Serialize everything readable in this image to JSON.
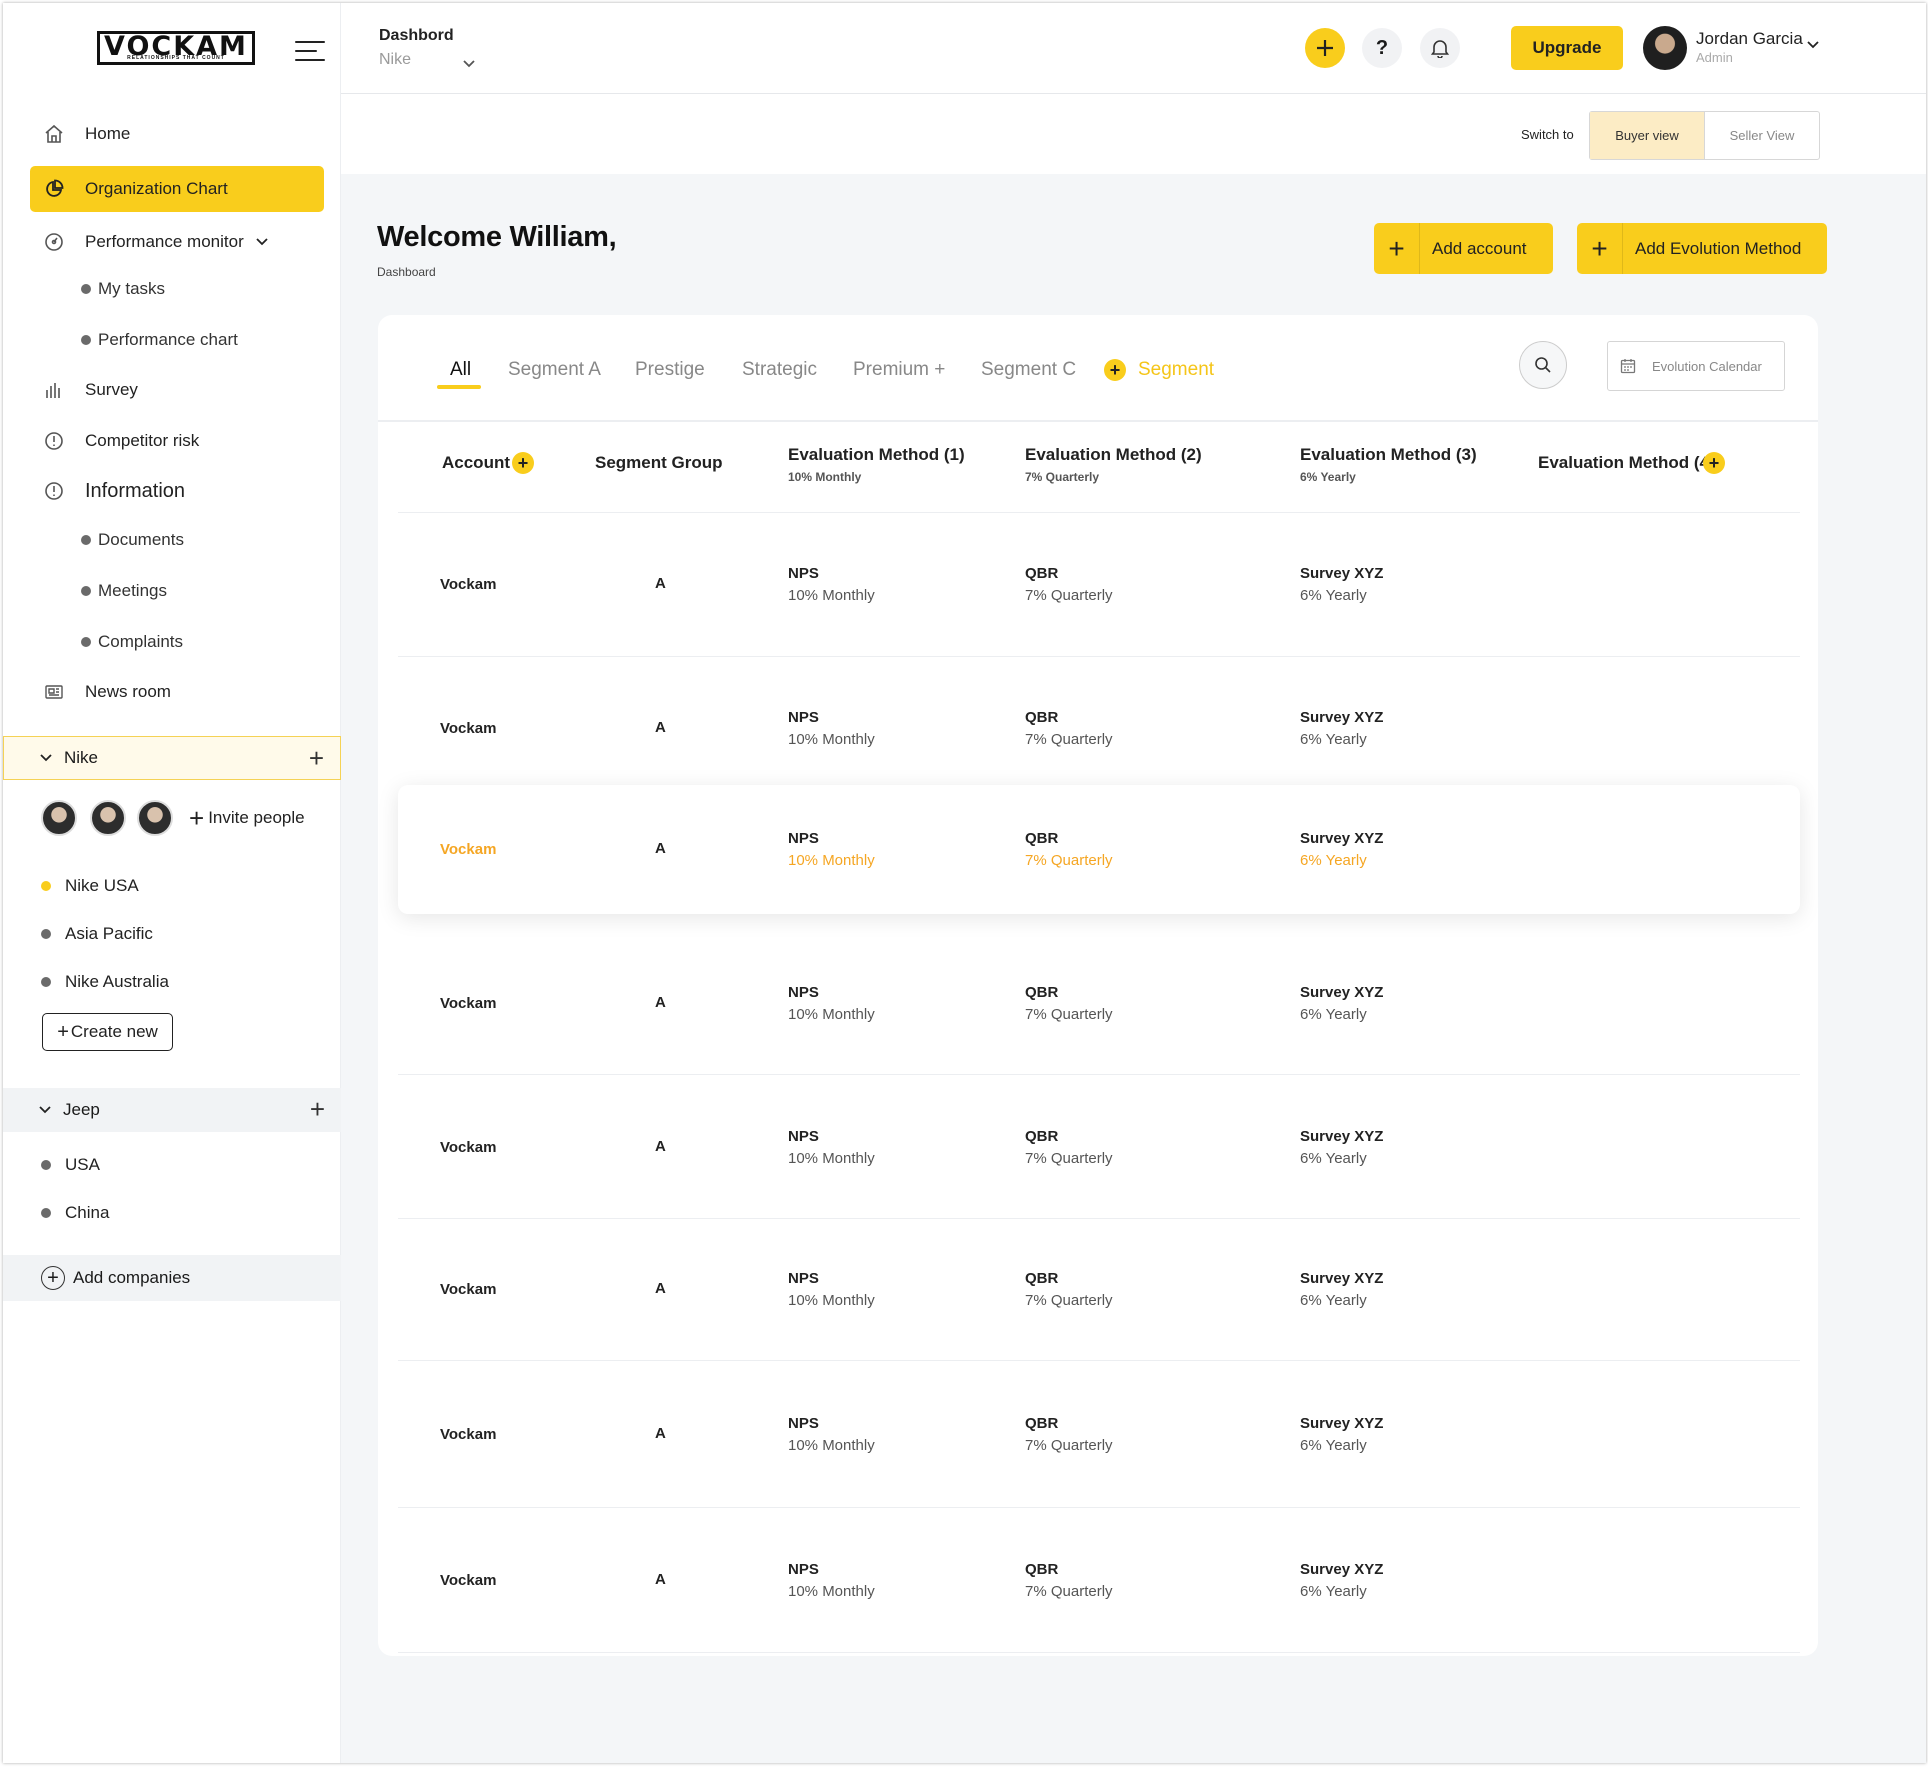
{
  "brand": {
    "name": "VOCKAM",
    "tagline": "RELATIONSHIPS THAT COUNT"
  },
  "nav": {
    "home": "Home",
    "org_chart": "Organization Chart",
    "performance_monitor": "Performance monitor",
    "my_tasks": "My tasks",
    "performance_chart": "Performance chart",
    "survey": "Survey",
    "competitor_risk": "Competitor risk",
    "information": "Information",
    "documents": "Documents",
    "meetings": "Meetings",
    "complaints": "Complaints",
    "news_room": "News room"
  },
  "groups": {
    "nike": {
      "name": "Nike",
      "invite": "Invite people",
      "companies": [
        "Nike USA",
        "Asia Pacific",
        "Nike Australia"
      ],
      "create": "Create new"
    },
    "jeep": {
      "name": "Jeep",
      "companies": [
        "USA",
        "China"
      ]
    },
    "add_companies": "Add companies"
  },
  "topbar": {
    "title": "Dashbord",
    "subtitle": "Nike",
    "help": "?",
    "upgrade": "Upgrade",
    "user_name": "Jordan Garcia",
    "user_role": "Admin"
  },
  "switch": {
    "label": "Switch to",
    "buyer": "Buyer view",
    "seller": "Seller View"
  },
  "welcome": {
    "title": "Welcome William,",
    "sub": "Dashboard"
  },
  "actions": {
    "add_account": "Add account",
    "add_method": "Add Evolution Method"
  },
  "tabs": [
    "All",
    "Segment A",
    "Prestige",
    "Strategic",
    "Premium +",
    "Segment C"
  ],
  "segment_add": "Segment",
  "calendar": "Evolution Calendar",
  "columns": {
    "account": "Account",
    "segment_group": "Segment Group",
    "em1": "Evaluation Method (1)",
    "em1_sub": "10% Monthly",
    "em2": "Evaluation Method (2)",
    "em2_sub": "7% Quarterly",
    "em3": "Evaluation Method (3)",
    "em3_sub": "6% Yearly",
    "em4": "Evaluation Method (4)"
  },
  "rows": [
    {
      "account": "Vockam",
      "segment": "A",
      "m1": "NPS",
      "m1s": "10%  Monthly",
      "m2": "QBR",
      "m2s": "7%  Quarterly",
      "m3": "Survey XYZ",
      "m3s": "6%  Yearly"
    },
    {
      "account": "Vockam",
      "segment": "A",
      "m1": "NPS",
      "m1s": "10%  Monthly",
      "m2": "QBR",
      "m2s": "7%  Quarterly",
      "m3": "Survey XYZ",
      "m3s": "6%  Yearly"
    },
    {
      "account": "Vockam",
      "segment": "A",
      "m1": "NPS",
      "m1s": "10%  Monthly",
      "m2": "QBR",
      "m2s": "7%  Quarterly",
      "m3": "Survey XYZ",
      "m3s": "6%  Yearly"
    },
    {
      "account": "Vockam",
      "segment": "A",
      "m1": "NPS",
      "m1s": "10%  Monthly",
      "m2": "QBR",
      "m2s": "7%  Quarterly",
      "m3": "Survey XYZ",
      "m3s": "6%  Yearly"
    },
    {
      "account": "Vockam",
      "segment": "A",
      "m1": "NPS",
      "m1s": "10%  Monthly",
      "m2": "QBR",
      "m2s": "7%  Quarterly",
      "m3": "Survey XYZ",
      "m3s": "6%  Yearly"
    },
    {
      "account": "Vockam",
      "segment": "A",
      "m1": "NPS",
      "m1s": "10%  Monthly",
      "m2": "QBR",
      "m2s": "7%  Quarterly",
      "m3": "Survey XYZ",
      "m3s": "6%  Yearly"
    },
    {
      "account": "Vockam",
      "segment": "A",
      "m1": "NPS",
      "m1s": "10%  Monthly",
      "m2": "QBR",
      "m2s": "7%  Quarterly",
      "m3": "Survey XYZ",
      "m3s": "6%  Yearly"
    },
    {
      "account": "Vockam",
      "segment": "A",
      "m1": "NPS",
      "m1s": "10%  Monthly",
      "m2": "QBR",
      "m2s": "7%  Quarterly",
      "m3": "Survey XYZ",
      "m3s": "6%  Yearly"
    }
  ],
  "colors": {
    "accent": "#f9cd1c",
    "highlight_text": "#f5a623"
  }
}
